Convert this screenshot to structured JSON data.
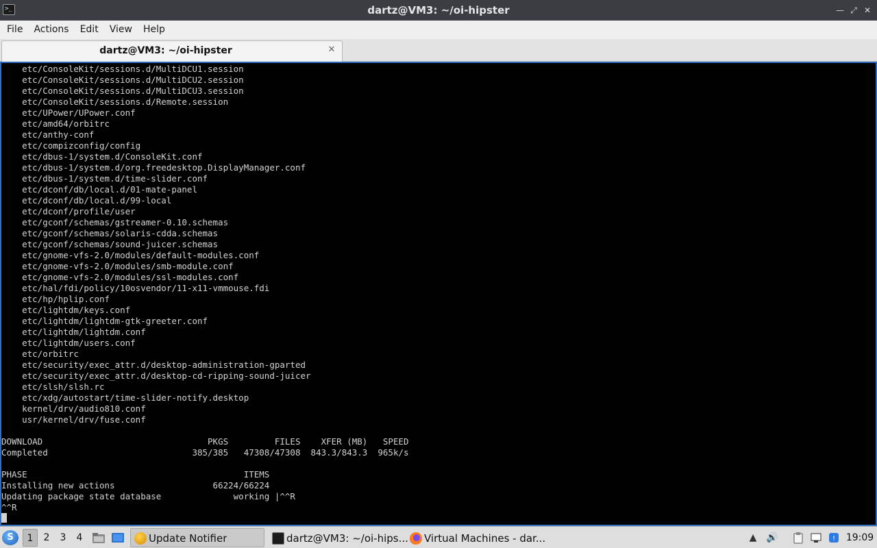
{
  "window": {
    "title": "dartz@VM3: ~/oi-hipster",
    "icon": "terminal-icon"
  },
  "menubar": {
    "items": [
      "File",
      "Actions",
      "Edit",
      "View",
      "Help"
    ]
  },
  "tabs": [
    {
      "label": "dartz@VM3: ~/oi-hipster",
      "active": true
    }
  ],
  "terminal": {
    "lines": [
      "    etc/ConsoleKit/sessions.d/MultiDCU1.session",
      "    etc/ConsoleKit/sessions.d/MultiDCU2.session",
      "    etc/ConsoleKit/sessions.d/MultiDCU3.session",
      "    etc/ConsoleKit/sessions.d/Remote.session",
      "    etc/UPower/UPower.conf",
      "    etc/amd64/orbitrc",
      "    etc/anthy-conf",
      "    etc/compizconfig/config",
      "    etc/dbus-1/system.d/ConsoleKit.conf",
      "    etc/dbus-1/system.d/org.freedesktop.DisplayManager.conf",
      "    etc/dbus-1/system.d/time-slider.conf",
      "    etc/dconf/db/local.d/01-mate-panel",
      "    etc/dconf/db/local.d/99-local",
      "    etc/dconf/profile/user",
      "    etc/gconf/schemas/gstreamer-0.10.schemas",
      "    etc/gconf/schemas/solaris-cdda.schemas",
      "    etc/gconf/schemas/sound-juicer.schemas",
      "    etc/gnome-vfs-2.0/modules/default-modules.conf",
      "    etc/gnome-vfs-2.0/modules/smb-module.conf",
      "    etc/gnome-vfs-2.0/modules/ssl-modules.conf",
      "    etc/hal/fdi/policy/10osvendor/11-x11-vmmouse.fdi",
      "    etc/hp/hplip.conf",
      "    etc/lightdm/keys.conf",
      "    etc/lightdm/lightdm-gtk-greeter.conf",
      "    etc/lightdm/lightdm.conf",
      "    etc/lightdm/users.conf",
      "    etc/orbitrc",
      "    etc/security/exec_attr.d/desktop-administration-gparted",
      "    etc/security/exec_attr.d/desktop-cd-ripping-sound-juicer",
      "    etc/slsh/slsh.rc",
      "    etc/xdg/autostart/time-slider-notify.desktop",
      "    kernel/drv/audio810.conf",
      "    usr/kernel/drv/fuse.conf",
      "",
      "DOWNLOAD                                PKGS         FILES    XFER (MB)   SPEED",
      "Completed                            385/385   47308/47308  843.3/843.3  965k/s",
      "",
      "PHASE                                          ITEMS",
      "Installing new actions                   66224/66224",
      "Updating package state database              working |^^R",
      "^^R"
    ]
  },
  "taskbar": {
    "start_icon": "start-menu-icon",
    "desktops": [
      "1",
      "2",
      "3",
      "4"
    ],
    "active_desktop": "1",
    "quick_launch": [
      "file-manager-icon",
      "show-desktop-icon"
    ],
    "tasks": [
      {
        "label": "Update Notifier",
        "icon": "update-notifier-icon",
        "active": true
      },
      {
        "label": "dartz@VM3: ~/oi-hips...",
        "icon": "terminal-icon",
        "active": false
      },
      {
        "label": "Virtual Machines - dar...",
        "icon": "firefox-icon",
        "active": false
      }
    ],
    "tray": [
      "tray-arrow-icon",
      "volume-icon",
      "clipboard-icon",
      "network-icon",
      "bluetooth-icon"
    ],
    "clock": "19:09"
  },
  "colors": {
    "titlebar": "#3a3d42",
    "terminal_bg": "#000000",
    "terminal_fg": "#d3d3d3",
    "terminal_border": "#2f6fc0",
    "taskbar": "#dedede"
  }
}
